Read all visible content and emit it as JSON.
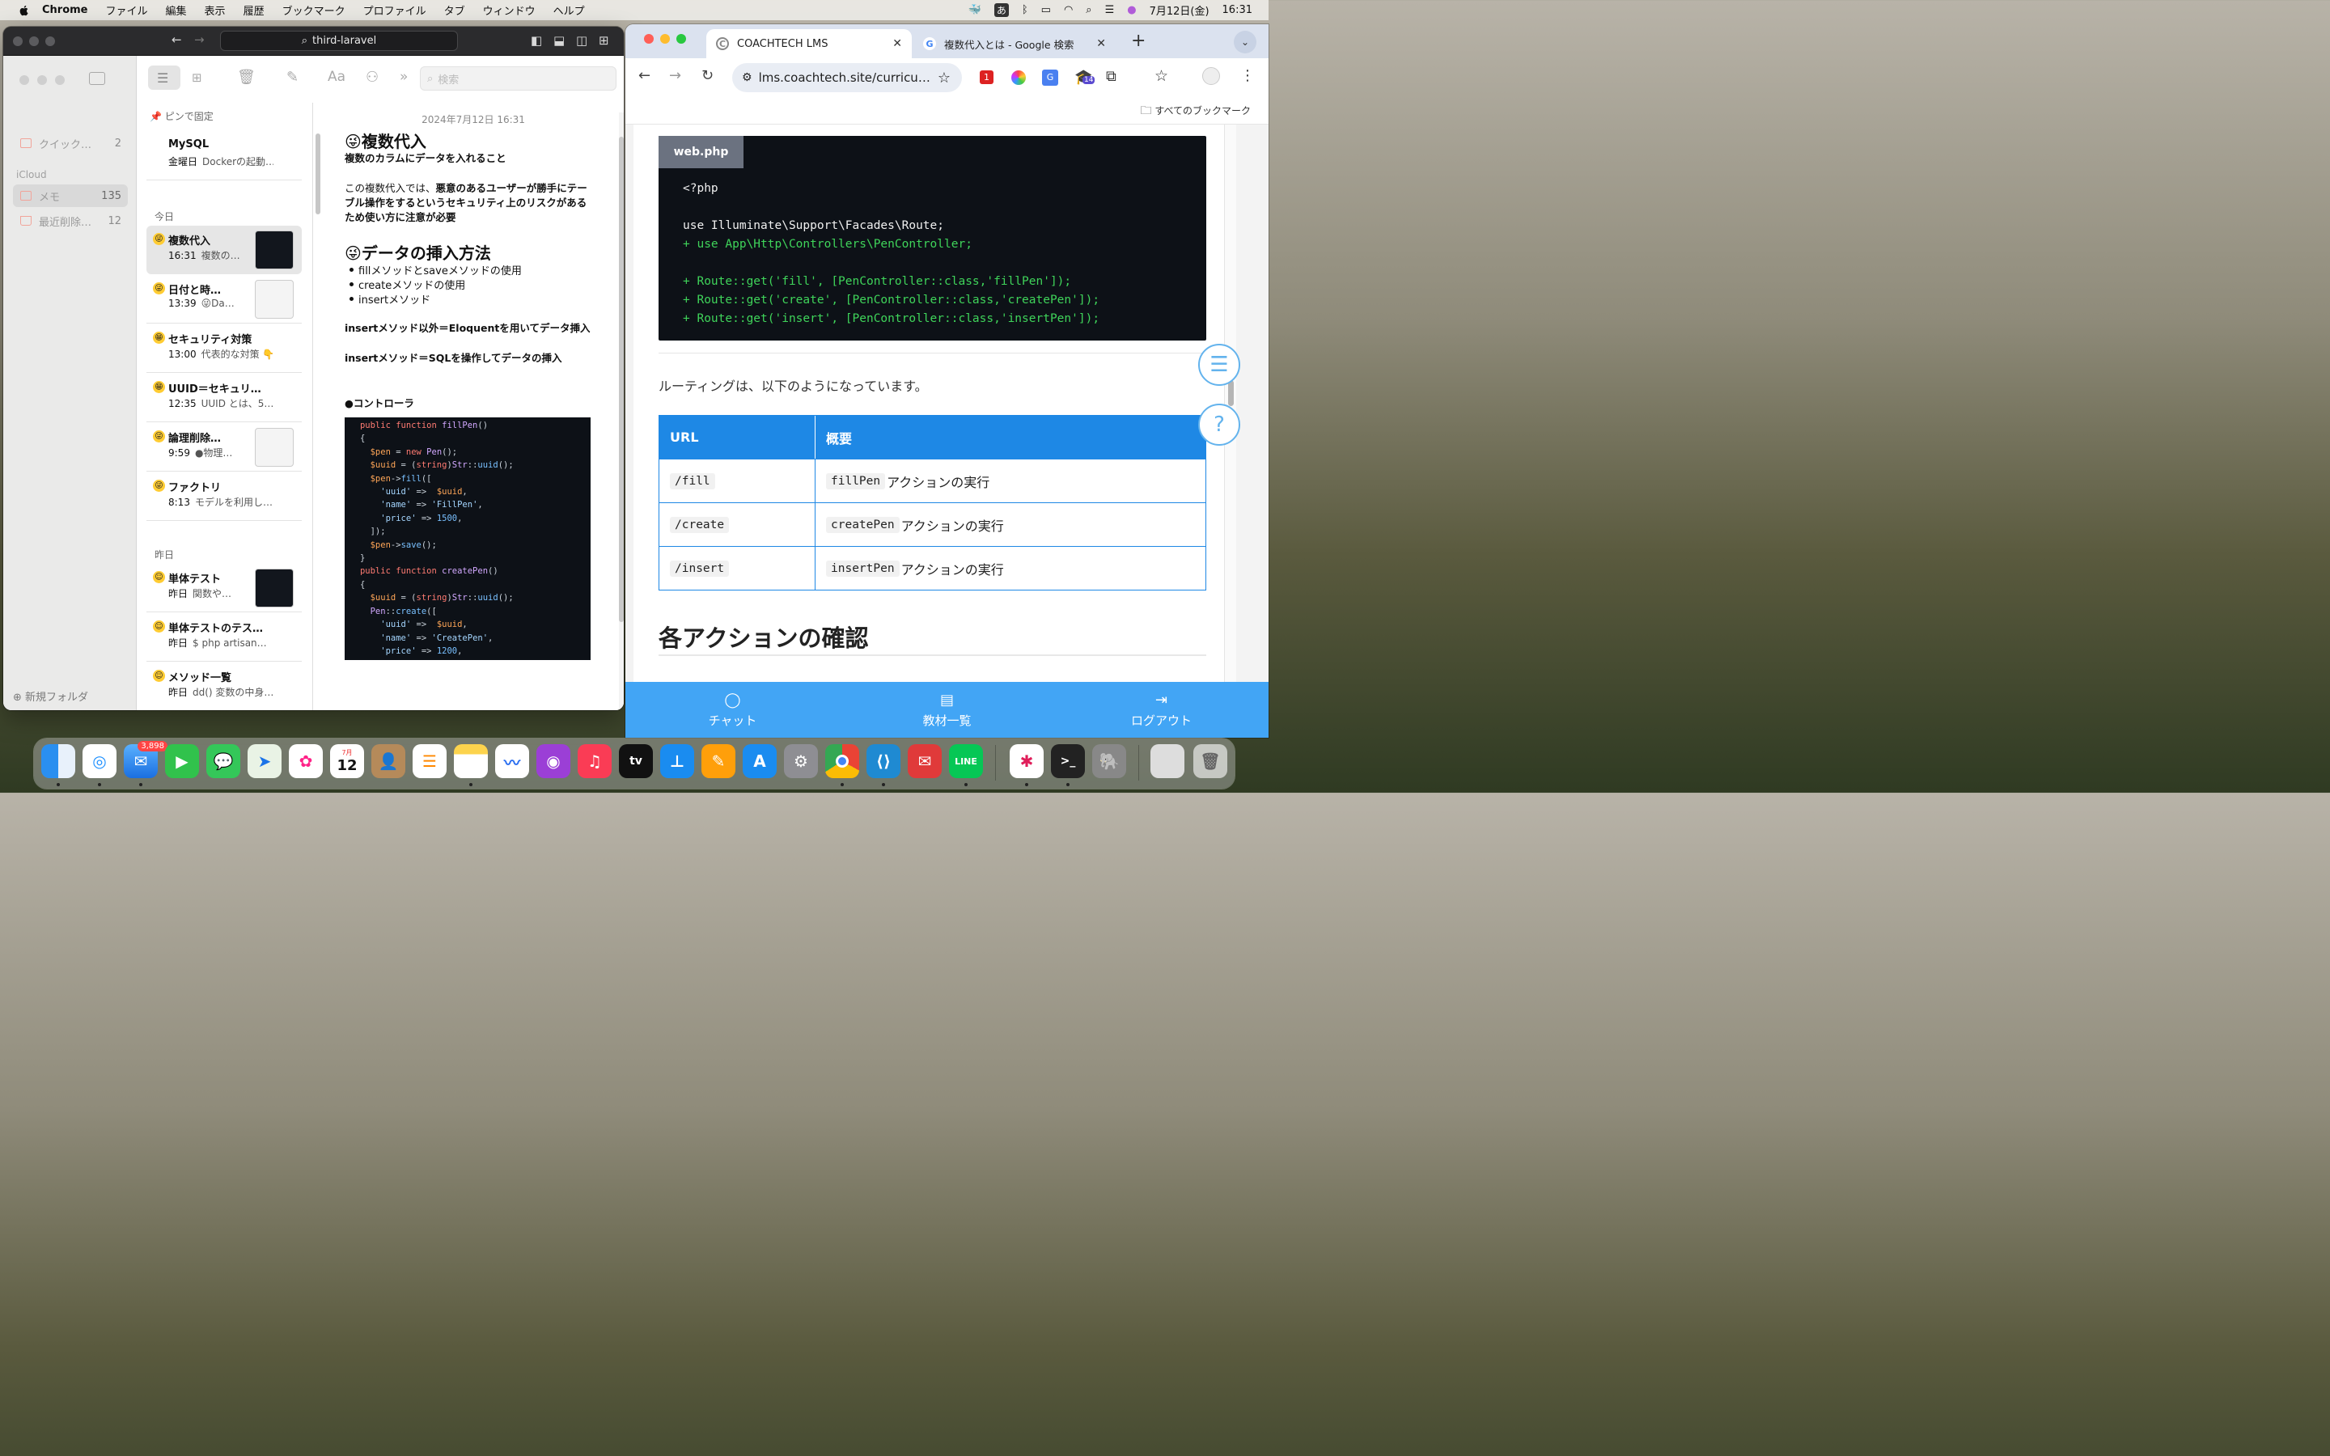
{
  "menubar": {
    "app_name": "Chrome",
    "items": [
      "ファイル",
      "編集",
      "表示",
      "履歴",
      "ブックマーク",
      "プロファイル",
      "タブ",
      "ウィンドウ",
      "ヘルプ"
    ],
    "input_mode": "あ",
    "date": "7月12日(金)",
    "time": "16:31"
  },
  "notes": {
    "url": "third-laravel",
    "search_placeholder": "検索",
    "sidebar": {
      "quick": {
        "label": "クイック…",
        "count": "2"
      },
      "section": "iCloud",
      "memo": {
        "label": "メモ",
        "count": "135"
      },
      "deleted": {
        "label": "最近削除…",
        "count": "12"
      },
      "new_folder": "新規フォルダ"
    },
    "pinned_label": "ピンで固定",
    "groups": {
      "today": "今日",
      "yesterday": "昨日"
    },
    "list": [
      {
        "title": "MySQL",
        "time": "金曜日",
        "snippet": "Dockerの起動…"
      },
      {
        "title": "複数代入",
        "time": "16:31",
        "snippet": "複数の…"
      },
      {
        "title": "日付と時…",
        "time": "13:39",
        "snippet": "😜Da…"
      },
      {
        "title": "セキュリティ対策",
        "time": "13:00",
        "snippet": "代表的な対策 👇"
      },
      {
        "title": "UUID＝セキュリ…",
        "time": "12:35",
        "snippet": "UUID とは、5…"
      },
      {
        "title": "論理削除…",
        "time": "9:59",
        "snippet": "●物理…"
      },
      {
        "title": "ファクトリ",
        "time": "8:13",
        "snippet": "モデルを利用し…"
      },
      {
        "title": "単体テスト",
        "time": "昨日",
        "snippet": "関数や…"
      },
      {
        "title": "単体テストのテス…",
        "time": "昨日",
        "snippet": "$ php artisan…"
      },
      {
        "title": "メソッド一覧",
        "time": "昨日",
        "snippet": "dd() 変数の中身…"
      }
    ],
    "editor": {
      "date": "2024年7月12日 16:31",
      "title": "😜複数代入",
      "subtitle": "複数のカラムにデータを入れること",
      "para1a": "この複数代入では、",
      "para1b": "悪意のあるユーザーが勝手にテーブル操作をするというセキュリティ上のリスクがあるため使い方に注意が必要",
      "heading2": "😜データの挿入方法",
      "bullets": [
        "fillメソッドとsaveメソッドの使用",
        "createメソッドの使用",
        "insertメソッド"
      ],
      "note1": "insertメソッド以外＝Eloquentを用いてデータ挿入",
      "note2": "insertメソッド＝SQLを操作してデータの挿入",
      "section": "●コントローラ"
    }
  },
  "chrome": {
    "tabs": [
      {
        "title": "COACHTECH LMS",
        "active": true
      },
      {
        "title": "複数代入とは - Google 検索",
        "active": false
      }
    ],
    "url": "lms.coachtech.site/curricu…",
    "bookmarks_label": "すべてのブックマーク",
    "extension_badge": "14",
    "page": {
      "file_label": "web.php",
      "code_lines": [
        "<?php",
        "",
        "use Illuminate\\Support\\Facades\\Route;",
        "+ use App\\Http\\Controllers\\PenController;",
        "",
        "+ Route::get('fill', [PenController::class,'fillPen']);",
        "+ Route::get('create', [PenController::class,'createPen']);",
        "+ Route::get('insert', [PenController::class,'insertPen']);"
      ],
      "routing_text": "ルーティングは、以下のようになっています。",
      "table": {
        "headers": [
          "URL",
          "概要"
        ],
        "rows": [
          {
            "url": "/fill",
            "code": "fillPen",
            "desc": "アクションの実行"
          },
          {
            "url": "/create",
            "code": "createPen",
            "desc": "アクションの実行"
          },
          {
            "url": "/insert",
            "code": "insertPen",
            "desc": "アクションの実行"
          }
        ]
      },
      "heading": "各アクションの確認"
    },
    "bottom_nav": {
      "chat": "チャット",
      "materials": "教材一覧",
      "logout": "ログアウト"
    }
  },
  "dock": {
    "mail_badge": "3,898",
    "calendar_month": "7月",
    "calendar_day": "12"
  },
  "colors": {
    "accent": "#1e88e5",
    "bottom_nav": "#42a5f5",
    "code_bg": "#0d1117",
    "code_added": "#3fd45a"
  }
}
